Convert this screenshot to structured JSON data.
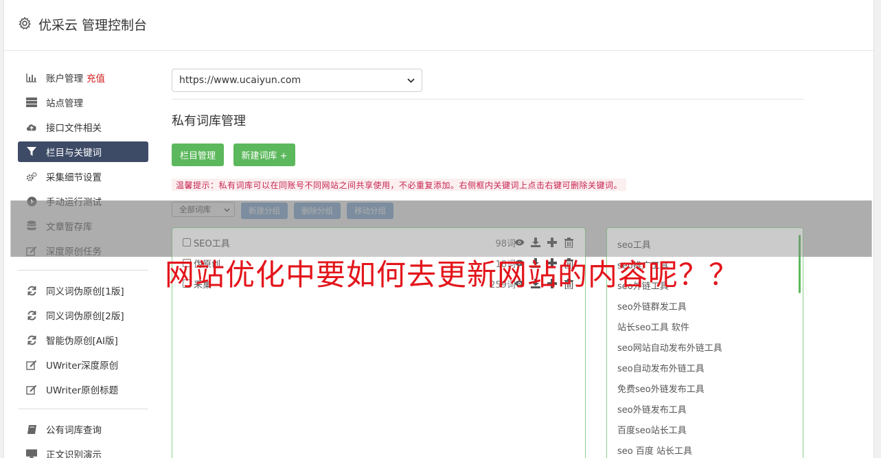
{
  "header": {
    "title": "优采云 管理控制台",
    "icon": "gear-icon"
  },
  "sidebar": {
    "items": [
      {
        "label": "账户管理",
        "badge": "充值",
        "icon": "bar-chart-icon"
      },
      {
        "label": "站点管理",
        "icon": "server-icon"
      },
      {
        "label": "接口文件相关",
        "icon": "cloud-upload-icon"
      },
      {
        "label": "栏目与关键词",
        "icon": "filter-icon",
        "active": true
      },
      {
        "label": "采集细节设置",
        "icon": "cogs-icon"
      },
      {
        "label": "手动运行测试",
        "icon": "play-circle-icon"
      },
      {
        "label": "文章暂存库",
        "icon": "database-icon"
      },
      {
        "label": "深度原创任务",
        "icon": "edit-icon"
      }
    ],
    "items2": [
      {
        "label": "同义词伪原创[1版]",
        "icon": "refresh-icon"
      },
      {
        "label": "同义词伪原创[2版]",
        "icon": "refresh-icon"
      },
      {
        "label": "智能伪原创[AI版]",
        "icon": "refresh-icon"
      },
      {
        "label": "UWriter深度原创",
        "icon": "edit-icon"
      },
      {
        "label": "UWriter原创标题",
        "icon": "edit-icon"
      }
    ],
    "items3": [
      {
        "label": "公有词库查询",
        "icon": "book-icon"
      },
      {
        "label": "正文识别演示",
        "icon": "monitor-icon"
      }
    ]
  },
  "main": {
    "site_select": "https://www.ucaiyun.com",
    "title": "私有词库管理",
    "btn_columns": "栏目管理",
    "btn_new_lib": "新建词库 +",
    "tip": "温馨提示：私有词库可以在同账号不同网站之间共享使用，不必重复添加。右侧框内关键词上点击右键可删除关键词。",
    "filter_select": "全部词库",
    "btn_new_group": "新建分组",
    "btn_del_group": "删除分组",
    "btn_move_group": "移动分组",
    "groups": [
      {
        "name": "SEO工具",
        "count": "98词"
      },
      {
        "name": "伪原创",
        "count": "18词"
      },
      {
        "name": "采集",
        "count": "259词"
      }
    ],
    "keywords": [
      "seo工具",
      "seo推广工具",
      "seo外链工具",
      "seo外链群发工具",
      "站长seo工具 软件",
      "seo网站自动发布外链工具",
      "seo自动发布外链工具",
      "免费seo外链发布工具",
      "seo外链发布工具",
      "百度seo站长工具",
      "seo 百度 站长工具"
    ]
  },
  "overlay": {
    "title": "网站优化中要如何去更新网站的内容呢？？"
  },
  "colors": {
    "green": "#5cb85c",
    "active_nav": "#3d4b67",
    "blue_btn": "#6fa0d6",
    "tip_text": "#c7254e",
    "overlay_title": "#e3151b"
  }
}
